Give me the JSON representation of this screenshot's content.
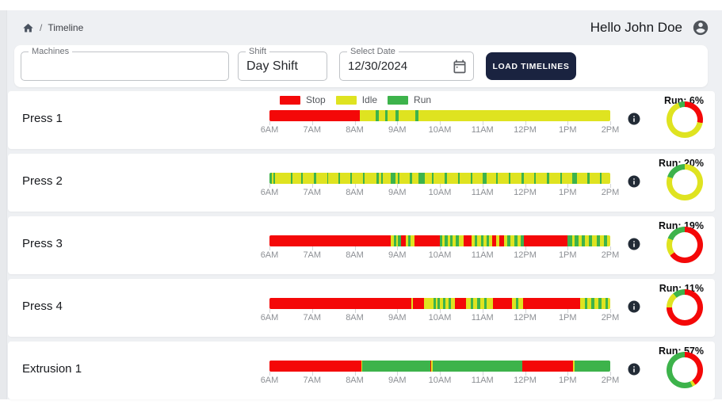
{
  "breadcrumb": {
    "home_icon": "home-icon",
    "separator": "/",
    "current": "Timeline"
  },
  "header": {
    "greeting": "Hello John Doe",
    "avatar_icon": "account-circle-icon"
  },
  "filters": {
    "machines": {
      "label": "Machines",
      "value": ""
    },
    "shift": {
      "label": "Shift",
      "value": "Day Shift"
    },
    "date": {
      "label": "Select Date",
      "value": "12/30/2024",
      "icon": "calendar-icon"
    },
    "load_button": "LOAD TIMELINES"
  },
  "legend": [
    {
      "state": "stop",
      "label": "Stop"
    },
    {
      "state": "idle",
      "label": "Idle"
    },
    {
      "state": "run",
      "label": "Run"
    }
  ],
  "colors": {
    "stop": "#f40808",
    "idle": "#dfe320",
    "run": "#3db34b",
    "button": "#1a2340",
    "info_icon": "#222b36",
    "page_bg": "#eef0f3"
  },
  "chart_data": {
    "type": "timeline",
    "time_axis": [
      "6AM",
      "7AM",
      "8AM",
      "9AM",
      "10AM",
      "11AM",
      "12PM",
      "1PM",
      "2PM"
    ],
    "x_range_hours": [
      6,
      14
    ],
    "states": {
      "stop": "Stop",
      "idle": "Idle",
      "run": "Run"
    },
    "machines": [
      {
        "name": "Press 1",
        "run_pct": 6,
        "run_label": "Run: 6%",
        "donut_segments": [
          [
            "stop",
            28
          ],
          [
            "idle",
            66
          ],
          [
            "run",
            6
          ]
        ],
        "segments": [
          [
            6.0,
            8.12,
            "stop"
          ],
          [
            8.12,
            8.5,
            "idle"
          ],
          [
            8.5,
            8.56,
            "run"
          ],
          [
            8.56,
            8.72,
            "idle"
          ],
          [
            8.72,
            8.78,
            "run"
          ],
          [
            8.78,
            8.95,
            "idle"
          ],
          [
            8.95,
            9.03,
            "run"
          ],
          [
            9.03,
            9.42,
            "idle"
          ],
          [
            9.42,
            9.5,
            "run"
          ],
          [
            9.5,
            14.0,
            "idle"
          ]
        ]
      },
      {
        "name": "Press 2",
        "run_pct": 20,
        "run_label": "Run: 20%",
        "donut_segments": [
          [
            "idle",
            80
          ],
          [
            "run",
            20
          ]
        ],
        "segments": [
          [
            6.0,
            6.06,
            "run"
          ],
          [
            6.06,
            6.1,
            "idle"
          ],
          [
            6.1,
            6.13,
            "run"
          ],
          [
            6.13,
            6.5,
            "idle"
          ],
          [
            6.5,
            6.54,
            "run"
          ],
          [
            6.54,
            6.75,
            "idle"
          ],
          [
            6.75,
            6.78,
            "run"
          ],
          [
            6.78,
            7.05,
            "idle"
          ],
          [
            7.05,
            7.09,
            "run"
          ],
          [
            7.09,
            7.35,
            "idle"
          ],
          [
            7.35,
            7.38,
            "run"
          ],
          [
            7.38,
            7.62,
            "idle"
          ],
          [
            7.62,
            7.65,
            "run"
          ],
          [
            7.65,
            7.9,
            "idle"
          ],
          [
            7.9,
            7.94,
            "run"
          ],
          [
            7.94,
            8.2,
            "idle"
          ],
          [
            8.2,
            8.24,
            "run"
          ],
          [
            8.24,
            8.52,
            "idle"
          ],
          [
            8.52,
            8.56,
            "run"
          ],
          [
            8.56,
            8.62,
            "idle"
          ],
          [
            8.62,
            8.66,
            "run"
          ],
          [
            8.66,
            8.85,
            "idle"
          ],
          [
            8.85,
            8.96,
            "run"
          ],
          [
            8.96,
            9.02,
            "idle"
          ],
          [
            9.02,
            9.06,
            "run"
          ],
          [
            9.06,
            9.3,
            "idle"
          ],
          [
            9.3,
            9.34,
            "run"
          ],
          [
            9.34,
            9.5,
            "idle"
          ],
          [
            9.5,
            9.64,
            "run"
          ],
          [
            9.64,
            9.82,
            "idle"
          ],
          [
            9.82,
            9.86,
            "run"
          ],
          [
            9.86,
            10.12,
            "idle"
          ],
          [
            10.12,
            10.16,
            "run"
          ],
          [
            10.16,
            10.42,
            "idle"
          ],
          [
            10.42,
            10.47,
            "run"
          ],
          [
            10.47,
            10.72,
            "idle"
          ],
          [
            10.72,
            10.76,
            "run"
          ],
          [
            10.76,
            11.0,
            "idle"
          ],
          [
            11.0,
            11.09,
            "run"
          ],
          [
            11.09,
            11.32,
            "idle"
          ],
          [
            11.32,
            11.36,
            "run"
          ],
          [
            11.36,
            11.62,
            "idle"
          ],
          [
            11.62,
            11.66,
            "run"
          ],
          [
            11.66,
            11.92,
            "idle"
          ],
          [
            11.92,
            11.97,
            "run"
          ],
          [
            11.97,
            12.22,
            "idle"
          ],
          [
            12.22,
            12.26,
            "run"
          ],
          [
            12.26,
            12.52,
            "idle"
          ],
          [
            12.52,
            12.57,
            "run"
          ],
          [
            12.57,
            12.82,
            "idle"
          ],
          [
            12.82,
            12.86,
            "run"
          ],
          [
            12.86,
            13.1,
            "idle"
          ],
          [
            13.1,
            13.21,
            "run"
          ],
          [
            13.21,
            13.46,
            "idle"
          ],
          [
            13.46,
            13.51,
            "run"
          ],
          [
            13.51,
            13.76,
            "idle"
          ],
          [
            13.76,
            13.8,
            "run"
          ],
          [
            13.8,
            14.0,
            "idle"
          ]
        ]
      },
      {
        "name": "Press 3",
        "run_pct": 19,
        "run_label": "Run: 19%",
        "donut_segments": [
          [
            "stop",
            65
          ],
          [
            "idle",
            16
          ],
          [
            "run",
            19
          ]
        ],
        "segments": [
          [
            6.0,
            8.85,
            "stop"
          ],
          [
            8.85,
            8.92,
            "idle"
          ],
          [
            8.92,
            8.97,
            "run"
          ],
          [
            8.97,
            9.02,
            "idle"
          ],
          [
            9.02,
            9.08,
            "run"
          ],
          [
            9.08,
            9.2,
            "stop"
          ],
          [
            9.2,
            9.26,
            "idle"
          ],
          [
            9.26,
            9.32,
            "run"
          ],
          [
            9.32,
            9.4,
            "idle"
          ],
          [
            9.4,
            10.0,
            "stop"
          ],
          [
            10.0,
            10.06,
            "run"
          ],
          [
            10.06,
            10.12,
            "idle"
          ],
          [
            10.12,
            10.18,
            "run"
          ],
          [
            10.18,
            10.24,
            "idle"
          ],
          [
            10.24,
            10.3,
            "run"
          ],
          [
            10.3,
            10.38,
            "idle"
          ],
          [
            10.38,
            10.44,
            "run"
          ],
          [
            10.44,
            10.55,
            "idle"
          ],
          [
            10.55,
            10.75,
            "stop"
          ],
          [
            10.75,
            10.82,
            "idle"
          ],
          [
            10.82,
            10.88,
            "run"
          ],
          [
            10.88,
            10.96,
            "idle"
          ],
          [
            10.96,
            11.02,
            "run"
          ],
          [
            11.02,
            11.1,
            "idle"
          ],
          [
            11.1,
            11.16,
            "run"
          ],
          [
            11.16,
            11.22,
            "idle"
          ],
          [
            11.22,
            11.32,
            "stop"
          ],
          [
            11.32,
            11.4,
            "idle"
          ],
          [
            11.4,
            11.5,
            "stop"
          ],
          [
            11.5,
            11.58,
            "idle"
          ],
          [
            11.58,
            11.66,
            "run"
          ],
          [
            11.66,
            11.75,
            "idle"
          ],
          [
            11.75,
            11.82,
            "run"
          ],
          [
            11.82,
            11.9,
            "idle"
          ],
          [
            11.9,
            11.97,
            "run"
          ],
          [
            11.97,
            13.0,
            "stop"
          ],
          [
            13.0,
            13.1,
            "run"
          ],
          [
            13.1,
            13.16,
            "idle"
          ],
          [
            13.16,
            13.25,
            "run"
          ],
          [
            13.25,
            13.33,
            "idle"
          ],
          [
            13.33,
            13.4,
            "run"
          ],
          [
            13.4,
            13.5,
            "idle"
          ],
          [
            13.5,
            13.58,
            "run"
          ],
          [
            13.58,
            13.68,
            "idle"
          ],
          [
            13.68,
            13.75,
            "run"
          ],
          [
            13.75,
            13.85,
            "idle"
          ],
          [
            13.85,
            13.92,
            "run"
          ],
          [
            13.92,
            14.0,
            "idle"
          ]
        ]
      },
      {
        "name": "Press 4",
        "run_pct": 11,
        "run_label": "Run: 11%",
        "donut_segments": [
          [
            "stop",
            75
          ],
          [
            "idle",
            14
          ],
          [
            "run",
            11
          ]
        ],
        "segments": [
          [
            6.0,
            9.33,
            "stop"
          ],
          [
            9.33,
            9.37,
            "idle"
          ],
          [
            9.37,
            9.62,
            "stop"
          ],
          [
            9.62,
            9.85,
            "idle"
          ],
          [
            9.85,
            9.9,
            "run"
          ],
          [
            9.9,
            9.95,
            "idle"
          ],
          [
            9.95,
            10.0,
            "run"
          ],
          [
            10.0,
            10.08,
            "idle"
          ],
          [
            10.08,
            10.13,
            "run"
          ],
          [
            10.13,
            10.2,
            "idle"
          ],
          [
            10.2,
            10.26,
            "run"
          ],
          [
            10.26,
            10.35,
            "idle"
          ],
          [
            10.35,
            10.62,
            "stop"
          ],
          [
            10.62,
            10.72,
            "idle"
          ],
          [
            10.72,
            10.78,
            "run"
          ],
          [
            10.78,
            10.88,
            "idle"
          ],
          [
            10.88,
            10.94,
            "run"
          ],
          [
            10.94,
            11.05,
            "idle"
          ],
          [
            11.05,
            11.1,
            "run"
          ],
          [
            11.1,
            11.25,
            "idle"
          ],
          [
            11.25,
            11.7,
            "stop"
          ],
          [
            11.7,
            11.78,
            "idle"
          ],
          [
            11.78,
            11.84,
            "run"
          ],
          [
            11.84,
            11.95,
            "idle"
          ],
          [
            11.95,
            13.3,
            "stop"
          ],
          [
            13.3,
            13.4,
            "idle"
          ],
          [
            13.4,
            13.46,
            "run"
          ],
          [
            13.46,
            13.55,
            "idle"
          ],
          [
            13.55,
            13.62,
            "run"
          ],
          [
            13.62,
            13.72,
            "idle"
          ],
          [
            13.72,
            13.8,
            "run"
          ],
          [
            13.8,
            13.88,
            "idle"
          ],
          [
            13.88,
            13.94,
            "run"
          ],
          [
            13.94,
            14.0,
            "idle"
          ]
        ]
      },
      {
        "name": "Extrusion 1",
        "run_pct": 57,
        "run_label": "Run: 57%",
        "donut_segments": [
          [
            "stop",
            40
          ],
          [
            "idle",
            3
          ],
          [
            "run",
            57
          ]
        ],
        "segments": [
          [
            6.0,
            8.15,
            "stop"
          ],
          [
            8.15,
            8.18,
            "idle"
          ],
          [
            8.18,
            9.77,
            "run"
          ],
          [
            9.77,
            9.8,
            "stop"
          ],
          [
            9.8,
            9.83,
            "idle"
          ],
          [
            9.83,
            11.93,
            "run"
          ],
          [
            11.93,
            13.13,
            "stop"
          ],
          [
            13.13,
            13.16,
            "idle"
          ],
          [
            13.16,
            14.0,
            "run"
          ]
        ]
      }
    ]
  }
}
